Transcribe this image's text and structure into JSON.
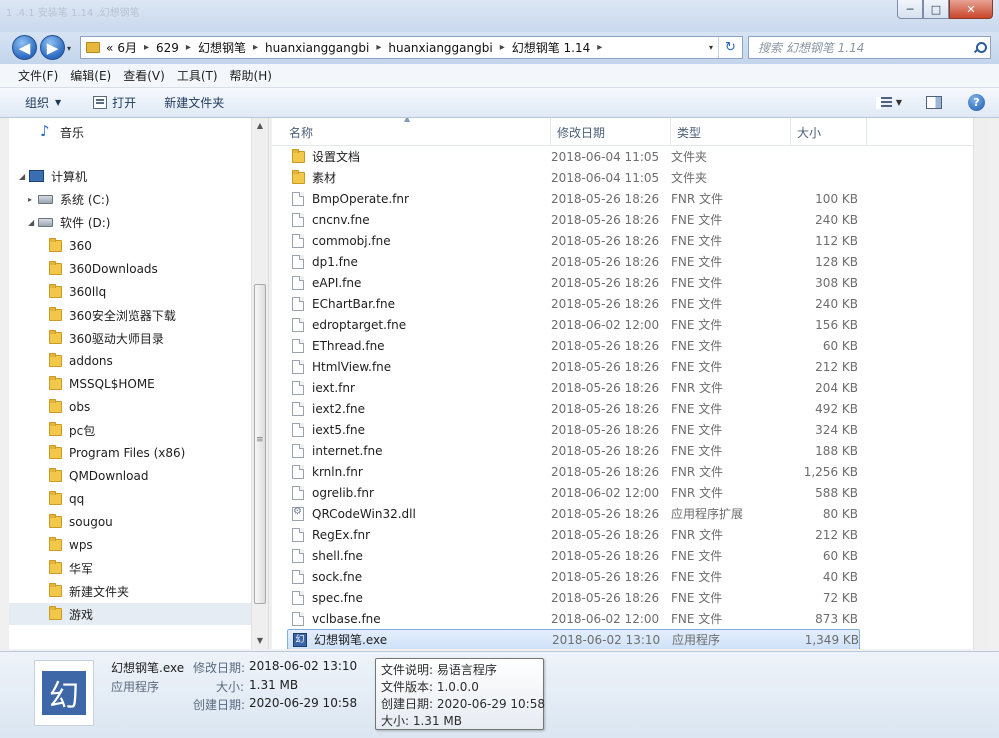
{
  "window": {
    "ghost_title": "1 .4.1 安装笔 1.14 ,幻想钢笔",
    "minimize": "─",
    "maximize": "□",
    "close": "✕"
  },
  "nav": {
    "back": "◀",
    "forward": "▶",
    "history_dropdown": "▾"
  },
  "address": {
    "overflow": "«",
    "crumbs": [
      "6月",
      "629",
      "幻想钢笔",
      "huanxianggangbi",
      "huanxianggangbi",
      "幻想钢笔 1.14"
    ],
    "separator": "▸",
    "dropdown": "▾",
    "refresh": "↻"
  },
  "search": {
    "placeholder": "搜索 幻想钢笔 1.14"
  },
  "menubar": {
    "items": [
      "文件(F)",
      "编辑(E)",
      "查看(V)",
      "工具(T)",
      "帮助(H)"
    ]
  },
  "toolbar": {
    "organize": "组织",
    "open": "打开",
    "new_folder": "新建文件夹",
    "help": "?",
    "dropdown": "▼"
  },
  "navtree": {
    "music": "音乐",
    "computer": "计算机",
    "drive_c": "系统 (C:)",
    "drive_d": "软件 (D:)",
    "folders": [
      "360",
      "360Downloads",
      "360llq",
      "360安全浏览器下载",
      "360驱动大师目录",
      "addons",
      "MSSQL$HOME",
      "obs",
      "pc包",
      "Program Files (x86)",
      "QMDownload",
      "qq",
      "sougou",
      "wps",
      "华军",
      "新建文件夹",
      "游戏"
    ],
    "selected_folder": "游戏",
    "expand_arrow": "▸",
    "expanded_arrow": "◢"
  },
  "list": {
    "columns": {
      "name": "名称",
      "date": "修改日期",
      "type": "类型",
      "size": "大小"
    },
    "sort_arrow": "▲",
    "files": [
      {
        "name": "设置文档",
        "date": "2018-06-04 11:05",
        "type": "文件夹",
        "size": "",
        "kind": "folder"
      },
      {
        "name": "素材",
        "date": "2018-06-04 11:05",
        "type": "文件夹",
        "size": "",
        "kind": "folder"
      },
      {
        "name": "BmpOperate.fnr",
        "date": "2018-05-26 18:26",
        "type": "FNR 文件",
        "size": "100 KB",
        "kind": "file"
      },
      {
        "name": "cncnv.fne",
        "date": "2018-05-26 18:26",
        "type": "FNE 文件",
        "size": "240 KB",
        "kind": "file"
      },
      {
        "name": "commobj.fne",
        "date": "2018-05-26 18:26",
        "type": "FNE 文件",
        "size": "112 KB",
        "kind": "file"
      },
      {
        "name": "dp1.fne",
        "date": "2018-05-26 18:26",
        "type": "FNE 文件",
        "size": "128 KB",
        "kind": "file"
      },
      {
        "name": "eAPI.fne",
        "date": "2018-05-26 18:26",
        "type": "FNE 文件",
        "size": "308 KB",
        "kind": "file"
      },
      {
        "name": "EChartBar.fne",
        "date": "2018-05-26 18:26",
        "type": "FNE 文件",
        "size": "240 KB",
        "kind": "file"
      },
      {
        "name": "edroptarget.fne",
        "date": "2018-06-02 12:00",
        "type": "FNE 文件",
        "size": "156 KB",
        "kind": "file"
      },
      {
        "name": "EThread.fne",
        "date": "2018-05-26 18:26",
        "type": "FNE 文件",
        "size": "60 KB",
        "kind": "file"
      },
      {
        "name": "HtmlView.fne",
        "date": "2018-05-26 18:26",
        "type": "FNE 文件",
        "size": "212 KB",
        "kind": "file"
      },
      {
        "name": "iext.fnr",
        "date": "2018-05-26 18:26",
        "type": "FNR 文件",
        "size": "204 KB",
        "kind": "file"
      },
      {
        "name": "iext2.fne",
        "date": "2018-05-26 18:26",
        "type": "FNE 文件",
        "size": "492 KB",
        "kind": "file"
      },
      {
        "name": "iext5.fne",
        "date": "2018-05-26 18:26",
        "type": "FNE 文件",
        "size": "324 KB",
        "kind": "file"
      },
      {
        "name": "internet.fne",
        "date": "2018-05-26 18:26",
        "type": "FNE 文件",
        "size": "188 KB",
        "kind": "file"
      },
      {
        "name": "krnln.fnr",
        "date": "2018-05-26 18:26",
        "type": "FNR 文件",
        "size": "1,256 KB",
        "kind": "file"
      },
      {
        "name": "ogrelib.fnr",
        "date": "2018-06-02 12:00",
        "type": "FNR 文件",
        "size": "588 KB",
        "kind": "file"
      },
      {
        "name": "QRCodeWin32.dll",
        "date": "2018-05-26 18:26",
        "type": "应用程序扩展",
        "size": "80 KB",
        "kind": "dll"
      },
      {
        "name": "RegEx.fnr",
        "date": "2018-05-26 18:26",
        "type": "FNR 文件",
        "size": "212 KB",
        "kind": "file"
      },
      {
        "name": "shell.fne",
        "date": "2018-05-26 18:26",
        "type": "FNE 文件",
        "size": "60 KB",
        "kind": "file"
      },
      {
        "name": "sock.fne",
        "date": "2018-05-26 18:26",
        "type": "FNE 文件",
        "size": "40 KB",
        "kind": "file"
      },
      {
        "name": "spec.fne",
        "date": "2018-05-26 18:26",
        "type": "FNE 文件",
        "size": "72 KB",
        "kind": "file"
      },
      {
        "name": "vclbase.fne",
        "date": "2018-06-02 12:00",
        "type": "FNE 文件",
        "size": "873 KB",
        "kind": "file"
      },
      {
        "name": "幻想钢笔.exe",
        "date": "2018-06-02 13:10",
        "type": "应用程序",
        "size": "1,349 KB",
        "kind": "exe"
      }
    ],
    "selected_index": 23
  },
  "details": {
    "icon_char": "幻",
    "filename": "幻想钢笔.exe",
    "filetype": "应用程序",
    "modified_label": "修改日期:",
    "modified_value": "2018-06-02 13:10",
    "size_label": "大小:",
    "size_value": "1.31 MB",
    "created_label": "创建日期:",
    "created_value": "2020-06-29 10:58"
  },
  "tooltip": {
    "lines": [
      "文件说明: 易语言程序",
      "文件版本: 1.0.0.0",
      "创建日期: 2020-06-29 10:58",
      "大小: 1.31 MB"
    ]
  },
  "colors": {
    "selection": "#cfe2f9",
    "folder": "#f2c84b",
    "exe_icon": "#3d67a6"
  }
}
